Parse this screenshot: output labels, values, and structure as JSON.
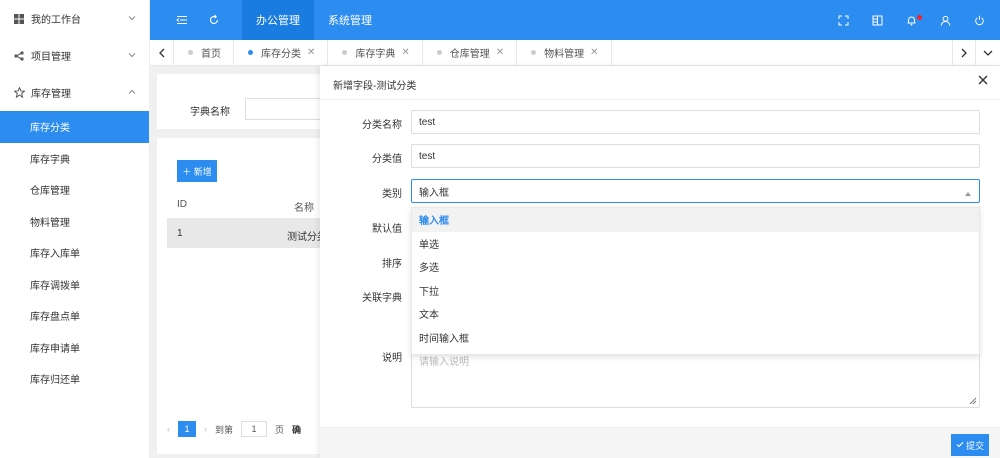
{
  "sidebar": {
    "groups": [
      {
        "label": "我的工作台",
        "icon": "windows-icon",
        "expanded": false
      },
      {
        "label": "项目管理",
        "icon": "share-icon",
        "expanded": false
      },
      {
        "label": "库存管理",
        "icon": "star-icon",
        "expanded": true
      }
    ],
    "items": [
      "库存分类",
      "库存字典",
      "仓库管理",
      "物料管理",
      "库存入库单",
      "库存调拨单",
      "库存盘点单",
      "库存申请单",
      "库存归还单"
    ],
    "active_item": "库存分类"
  },
  "topbar": {
    "nav": [
      "办公管理",
      "系统管理"
    ],
    "active_nav": "办公管理",
    "icons": [
      "menu-toggle-icon",
      "refresh-icon",
      "fullscreen-icon",
      "theme-icon",
      "bell-icon",
      "user-icon",
      "power-icon"
    ]
  },
  "tabs": {
    "items": [
      {
        "label": "首页",
        "closable": false,
        "active": false
      },
      {
        "label": "库存分类",
        "closable": true,
        "active": true
      },
      {
        "label": "库存字典",
        "closable": true,
        "active": false
      },
      {
        "label": "仓库管理",
        "closable": true,
        "active": false
      },
      {
        "label": "物料管理",
        "closable": true,
        "active": false
      }
    ]
  },
  "background": {
    "search_label": "字典名称",
    "add_button": "新增",
    "columns": [
      "ID",
      "名称"
    ],
    "row": {
      "id": "1",
      "name": "测试分类"
    },
    "pager": {
      "current": "1",
      "goto_label": "到第",
      "page_input": "1",
      "page_unit": "页",
      "confirm": "确"
    }
  },
  "modal": {
    "title": "新增字段-测试分类",
    "fields": [
      {
        "label": "分类名称",
        "value": "test"
      },
      {
        "label": "分类值",
        "value": "test"
      },
      {
        "label": "类别",
        "value": "输入框"
      },
      {
        "label": "默认值",
        "value": ""
      },
      {
        "label": "排序",
        "value": ""
      },
      {
        "label": "关联字典",
        "value": ""
      },
      {
        "label": "说明",
        "value": ""
      }
    ],
    "description_placeholder": "请输入说明",
    "dropdown_options": [
      "输入框",
      "单选",
      "多选",
      "下拉",
      "文本",
      "时间输入框"
    ],
    "selected_option": "输入框",
    "submit_label": "提交"
  },
  "colors": {
    "primary": "#2d8cf0",
    "badge": "#f5222d"
  }
}
